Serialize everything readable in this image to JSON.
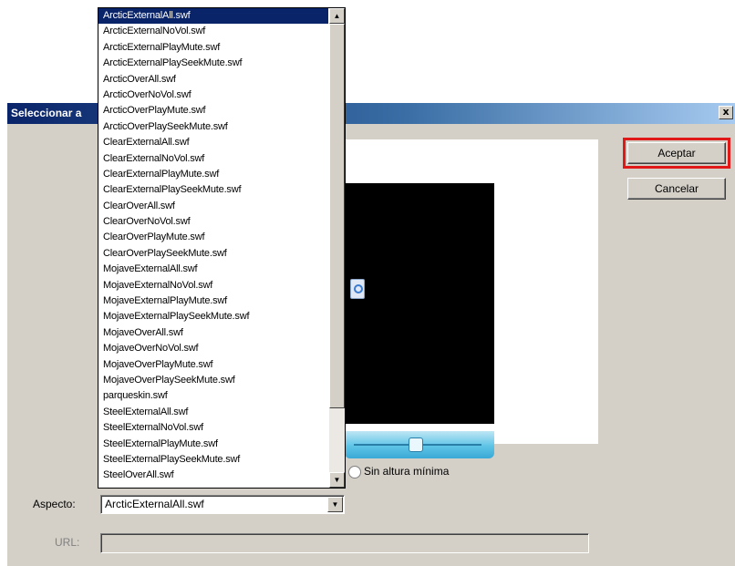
{
  "dialog": {
    "title": "Seleccionar a",
    "close_label": "x",
    "accept_label": "Aceptar",
    "cancel_label": "Cancelar",
    "min_height_label": "Sin altura mínima",
    "aspect_label": "Aspecto:",
    "aspect_value": "ArcticExternalAll.swf",
    "url_label": "URL:",
    "url_value": ""
  },
  "dropdown": {
    "selected": "ArcticExternalAll.swf",
    "items": [
      "ArcticExternalAll.swf",
      "ArcticExternalNoVol.swf",
      "ArcticExternalPlayMute.swf",
      "ArcticExternalPlaySeekMute.swf",
      "ArcticOverAll.swf",
      "ArcticOverNoVol.swf",
      "ArcticOverPlayMute.swf",
      "ArcticOverPlaySeekMute.swf",
      "ClearExternalAll.swf",
      "ClearExternalNoVol.swf",
      "ClearExternalPlayMute.swf",
      "ClearExternalPlaySeekMute.swf",
      "ClearOverAll.swf",
      "ClearOverNoVol.swf",
      "ClearOverPlayMute.swf",
      "ClearOverPlaySeekMute.swf",
      "MojaveExternalAll.swf",
      "MojaveExternalNoVol.swf",
      "MojaveExternalPlayMute.swf",
      "MojaveExternalPlaySeekMute.swf",
      "MojaveOverAll.swf",
      "MojaveOverNoVol.swf",
      "MojaveOverPlayMute.swf",
      "MojaveOverPlaySeekMute.swf",
      "parqueskin.swf",
      "SteelExternalAll.swf",
      "SteelExternalNoVol.swf",
      "SteelExternalPlayMute.swf",
      "SteelExternalPlaySeekMute.swf",
      "SteelOverAll.swf"
    ]
  },
  "icons": {
    "close": "close-icon",
    "combo_arrow": "chevron-down-icon",
    "scroll_up": "scroll-up-icon",
    "scroll_down": "scroll-down-icon",
    "play": "play-icon"
  },
  "colors": {
    "selection": "#0a246a",
    "highlight_box": "#e01818",
    "video_controls": "#5ec4e6"
  }
}
